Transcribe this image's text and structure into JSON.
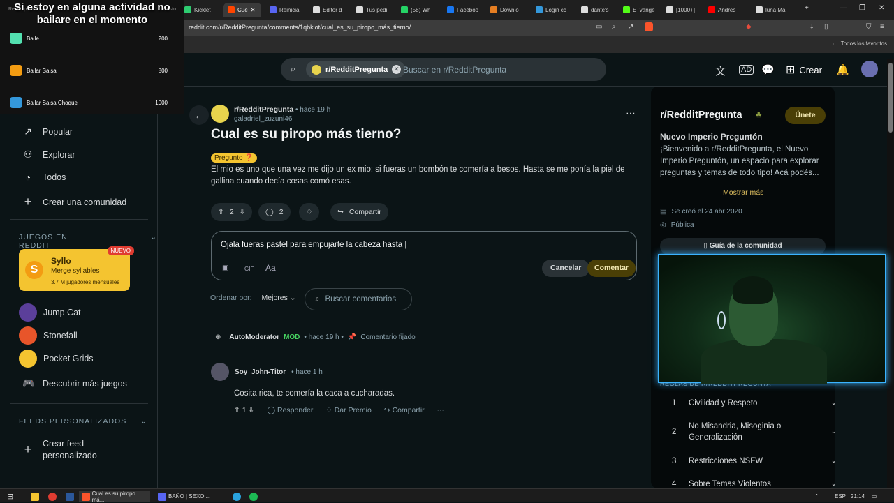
{
  "tabs": [
    {
      "label": "Kicklet",
      "color": "#2ecc71"
    },
    {
      "label": "Cue",
      "color": "#ff4500",
      "active": true
    },
    {
      "label": "Reinicia",
      "color": "#5865f2"
    },
    {
      "label": "Editor d",
      "color": "#ddd"
    },
    {
      "label": "Tus pedi",
      "color": "#ddd"
    },
    {
      "label": "(58) Wh",
      "color": "#25d366"
    },
    {
      "label": "Faceboo",
      "color": "#1877f2"
    },
    {
      "label": "Downlo",
      "color": "#e67e22"
    },
    {
      "label": "Login cc",
      "color": "#3498db"
    },
    {
      "label": "dante's",
      "color": "#ddd"
    },
    {
      "label": "E_vange",
      "color": "#53fc18"
    },
    {
      "label": "[1000+]",
      "color": "#ddd"
    },
    {
      "label": "Andres",
      "color": "#ff0000"
    },
    {
      "label": "luna Ma",
      "color": "#ddd"
    }
  ],
  "url": "reddit.com/r/RedditPregunta/comments/1qbklot/cual_es_su_piropo_más_tierno/",
  "favorites_folder": "Todos los favoritos",
  "overlay": {
    "title": "Si estoy en alguna actividad no bailare en el momento",
    "head_left": "Recompensa",
    "head_right": "Costo",
    "rewards": [
      {
        "name": "Baile",
        "cost": "200",
        "color": "#53e0b0"
      },
      {
        "name": "Bailar Salsa",
        "cost": "800",
        "color": "#f39c12"
      },
      {
        "name": "Bailar Salsa Choque",
        "cost": "1000",
        "color": "#3498db"
      }
    ]
  },
  "header": {
    "chip": "r/RedditPregunta",
    "search_placeholder": "Buscar en r/RedditPregunta",
    "create": "Crear"
  },
  "sidebar": {
    "nav": [
      "Popular",
      "Explorar",
      "Todos",
      "Crear una comunidad"
    ],
    "games_header": "JUEGOS EN REDDIT",
    "syllo": {
      "title": "Syllo",
      "subtitle": "Merge syllables",
      "meta": "3.7 M jugadores mensuales",
      "badge": "NUEVO"
    },
    "games": [
      "Jump Cat",
      "Stonefall",
      "Pocket Grids",
      "Descubrir más juegos"
    ],
    "feeds_header": "FEEDS PERSONALIZADOS",
    "create_feed": "Crear feed personalizado"
  },
  "post": {
    "subreddit": "r/RedditPregunta",
    "time": "• hace 19 h",
    "author": "galadriel_zuzuni46",
    "title": "Cual es su piropo más tierno?",
    "flair": "Pregunto ❓",
    "body": "El mio es uno que una vez me dijo un ex mio: si fueras un bombón te comería a besos. Hasta se me ponía la piel de gallina cuando decía cosas comó esas.",
    "votes": "2",
    "comments": "2",
    "share": "Compartir"
  },
  "comment_box": {
    "text": "Ojala fueras pastel para empujarte la cabeza hasta |",
    "gif": "GIF",
    "aa": "Aa",
    "cancel": "Cancelar",
    "submit": "Comentar"
  },
  "sort": {
    "label": "Ordenar por:",
    "value": "Mejores",
    "search": "Buscar comentarios"
  },
  "automod": {
    "name": "AutoModerator",
    "badge": "MOD",
    "time": "• hace 19 h •",
    "pinned": "Comentario fijado"
  },
  "comment": {
    "author": "Soy_John-Titor",
    "time": "• hace 1 h",
    "text": "Cosita rica, te comería la caca a cucharadas.",
    "votes": "1",
    "reply": "Responder",
    "award": "Dar Premio",
    "share": "Compartir"
  },
  "right": {
    "name": "r/RedditPregunta",
    "join": "Únete",
    "subtitle": "Nuevo Imperio Preguntón",
    "desc": "¡Bienvenido a r/RedditPregunta, el Nuevo Imperio Preguntón, un espacio para explorar preguntas y temas de todo tipo! Acá podés...",
    "more": "Mostrar más",
    "created": "Se creó el 24 abr 2020",
    "public": "Pública",
    "guide": "Guía de la comunidad",
    "rules_header": "REGLAS DE R/REDDITPREGUNTA",
    "rules": [
      {
        "n": "1",
        "t": "Civilidad y Respeto"
      },
      {
        "n": "2",
        "t": "No Misandria, Misoginia o Generalización"
      },
      {
        "n": "3",
        "t": "Restricciones NSFW"
      },
      {
        "n": "4",
        "t": "Sobre Temas Violentos"
      }
    ]
  },
  "taskbar": {
    "app1": "Cual es su piropo má...",
    "app2": "BAÑO | SEXO ...",
    "lang": "ESP",
    "time": "21:14"
  }
}
